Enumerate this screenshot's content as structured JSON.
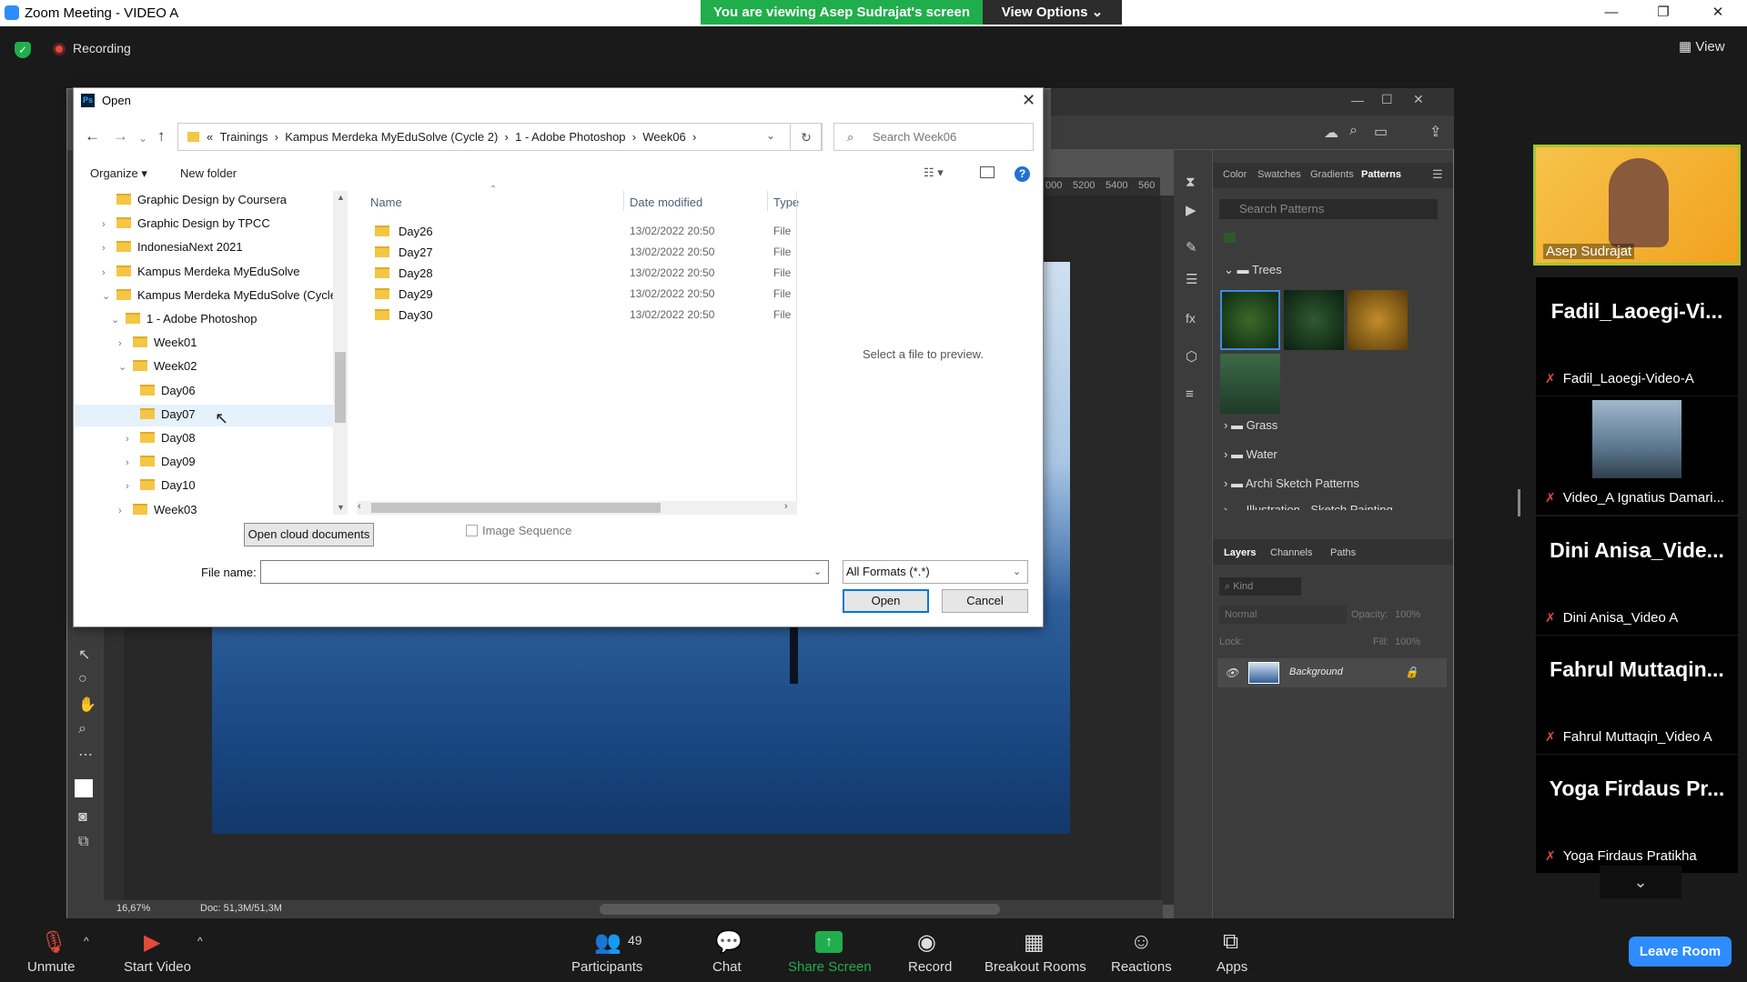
{
  "window": {
    "title": "Zoom Meeting - VIDEO A"
  },
  "banner": {
    "viewing": "You are viewing Asep Sudrajat's screen",
    "view_options": "View Options"
  },
  "status": {
    "recording": "Recording",
    "view": "View"
  },
  "dialog": {
    "title": "Open",
    "address": [
      "«",
      "Trainings",
      "Kampus Merdeka MyEduSolve (Cycle 2)",
      "1 - Adobe Photoshop",
      "Week06"
    ],
    "search_placeholder": "Search Week06",
    "organize": "Organize",
    "new_folder": "New folder",
    "tree": [
      {
        "label": "Graphic Design by Coursera",
        "indent": 0,
        "arrow": ""
      },
      {
        "label": "Graphic Design by TPCC",
        "indent": 0,
        "arrow": ">"
      },
      {
        "label": "IndonesiaNext 2021",
        "indent": 0,
        "arrow": ">"
      },
      {
        "label": "Kampus Merdeka MyEduSolve",
        "indent": 0,
        "arrow": ">"
      },
      {
        "label": "Kampus Merdeka MyEduSolve (Cycle",
        "indent": 0,
        "arrow": "v"
      },
      {
        "label": "1 - Adobe Photoshop",
        "indent": 1,
        "arrow": "v"
      },
      {
        "label": "Week01",
        "indent": 2,
        "arrow": ">"
      },
      {
        "label": "Week02",
        "indent": 2,
        "arrow": "v"
      },
      {
        "label": "Day06",
        "indent": 3,
        "arrow": ""
      },
      {
        "label": "Day07",
        "indent": 3,
        "arrow": ""
      },
      {
        "label": "Day08",
        "indent": 3,
        "arrow": ">"
      },
      {
        "label": "Day09",
        "indent": 3,
        "arrow": ">"
      },
      {
        "label": "Day10",
        "indent": 3,
        "arrow": ">"
      },
      {
        "label": "Week03",
        "indent": 2,
        "arrow": ">"
      }
    ],
    "columns": {
      "name": "Name",
      "date": "Date modified",
      "type": "Type"
    },
    "files": [
      {
        "name": "Day26",
        "date": "13/02/2022 20:50",
        "type": "File"
      },
      {
        "name": "Day27",
        "date": "13/02/2022 20:50",
        "type": "File"
      },
      {
        "name": "Day28",
        "date": "13/02/2022 20:50",
        "type": "File"
      },
      {
        "name": "Day29",
        "date": "13/02/2022 20:50",
        "type": "File"
      },
      {
        "name": "Day30",
        "date": "13/02/2022 20:50",
        "type": "File"
      }
    ],
    "preview": "Select a file to preview.",
    "cloud_button": "Open cloud documents",
    "image_sequence": "Image Sequence",
    "file_name_label": "File name:",
    "format": "All Formats (*.*)",
    "open_button": "Open",
    "cancel_button": "Cancel"
  },
  "photoshop": {
    "ruler": [
      "000",
      "5200",
      "5400",
      "560"
    ],
    "panel_tabs": [
      "Color",
      "Swatches",
      "Gradients",
      "Patterns"
    ],
    "pattern_search": "Search Patterns",
    "groups": [
      "Trees",
      "Grass",
      "Water",
      "Archi Sketch Patterns",
      "Illustration - Sketch Painting"
    ],
    "layer_tabs": [
      "Layers",
      "Channels",
      "Paths"
    ],
    "kind": "Kind",
    "blend": "Normal",
    "opacity_label": "Opacity:",
    "opacity": "100%",
    "lock_label": "Lock:",
    "fill_label": "Fill:",
    "fill": "100%",
    "layer_name": "Background",
    "zoom": "16,67%",
    "doc": "Doc: 51,3M/51,3M"
  },
  "gallery": {
    "featured": "Asep Sudrajat",
    "tiles": [
      {
        "big": "Fadil_Laoegi-Vi...",
        "sub": "Fadil_Laoegi-Video-A"
      },
      {
        "big": "",
        "sub": "Video_A Ignatius Damari..."
      },
      {
        "big": "Dini  Anisa_Vide...",
        "sub": "Dini Anisa_Video A"
      },
      {
        "big": "Fahrul  Muttaqin...",
        "sub": "Fahrul Muttaqin_Video A"
      },
      {
        "big": "Yoga Firdaus Pr...",
        "sub": "Yoga Firdaus Pratikha"
      }
    ]
  },
  "toolbar": {
    "unmute": "Unmute",
    "start_video": "Start Video",
    "participants": "Participants",
    "participants_count": "49",
    "chat": "Chat",
    "share": "Share Screen",
    "record": "Record",
    "breakout": "Breakout Rooms",
    "reactions": "Reactions",
    "apps": "Apps",
    "leave": "Leave Room"
  }
}
